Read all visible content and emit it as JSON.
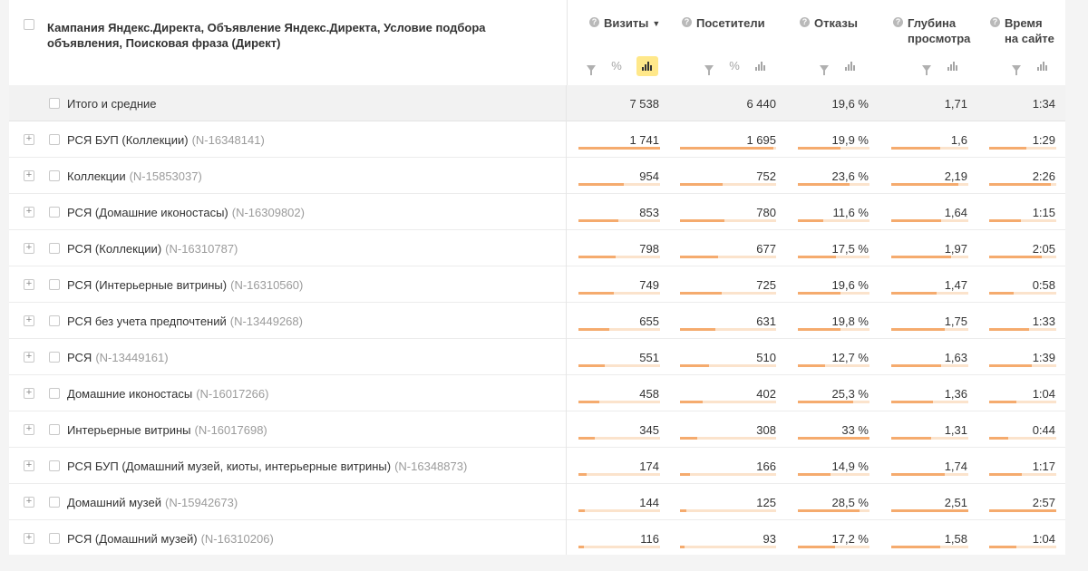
{
  "header": {
    "dimension_title": "Кампания Яндекс.Директа, Объявление Яндекс.Директа, Условие подбора объявления, Поисковая фраза (Директ)",
    "columns": [
      {
        "key": "visits",
        "title_line1": "Визиты",
        "title_line2": "",
        "sorted": true,
        "sort_glyph": "▼"
      },
      {
        "key": "visitors",
        "title_line1": "Посетители",
        "title_line2": "",
        "sorted": false,
        "sort_glyph": ""
      },
      {
        "key": "bounces",
        "title_line1": "Отказы",
        "title_line2": "",
        "sorted": false,
        "sort_glyph": ""
      },
      {
        "key": "depth",
        "title_line1": "Глубина",
        "title_line2": "просмотра",
        "sorted": false,
        "sort_glyph": ""
      },
      {
        "key": "time",
        "title_line1": "Время",
        "title_line2": "на сайте",
        "sorted": false,
        "sort_glyph": ""
      }
    ],
    "help_glyph": "?",
    "percent_glyph": "%"
  },
  "total_row": {
    "label": "Итого и средние",
    "values": [
      "7 538",
      "6 440",
      "19,6 %",
      "1,71",
      "1:34"
    ]
  },
  "rows": [
    {
      "name": "РСЯ БУП (Коллекции)",
      "id": "(N-16348141)",
      "values": [
        "1 741",
        "1 695",
        "19,9 %",
        "1,6",
        "1:29"
      ],
      "fractions": [
        1.0,
        0.97,
        0.6,
        0.64,
        0.56
      ]
    },
    {
      "name": "Коллекции",
      "id": "(N-15853037)",
      "values": [
        "954",
        "752",
        "23,6 %",
        "2,19",
        "2:26"
      ],
      "fractions": [
        0.55,
        0.44,
        0.72,
        0.87,
        0.92
      ]
    },
    {
      "name": "РСЯ (Домашние иконостасы)",
      "id": "(N-16309802)",
      "values": [
        "853",
        "780",
        "11,6 %",
        "1,64",
        "1:15"
      ],
      "fractions": [
        0.49,
        0.46,
        0.35,
        0.65,
        0.47
      ]
    },
    {
      "name": "РСЯ (Коллекции)",
      "id": "(N-16310787)",
      "values": [
        "798",
        "677",
        "17,5 %",
        "1,97",
        "2:05"
      ],
      "fractions": [
        0.46,
        0.4,
        0.53,
        0.78,
        0.79
      ]
    },
    {
      "name": "РСЯ (Интерьерные витрины)",
      "id": "(N-16310560)",
      "values": [
        "749",
        "725",
        "19,6 %",
        "1,47",
        "0:58"
      ],
      "fractions": [
        0.43,
        0.43,
        0.59,
        0.59,
        0.37
      ]
    },
    {
      "name": "РСЯ без учета предпочтений",
      "id": "(N-13449268)",
      "values": [
        "655",
        "631",
        "19,8 %",
        "1,75",
        "1:33"
      ],
      "fractions": [
        0.38,
        0.37,
        0.6,
        0.7,
        0.59
      ]
    },
    {
      "name": "РСЯ",
      "id": "(N-13449161)",
      "values": [
        "551",
        "510",
        "12,7 %",
        "1,63",
        "1:39"
      ],
      "fractions": [
        0.32,
        0.3,
        0.38,
        0.65,
        0.63
      ]
    },
    {
      "name": "Домашние иконостасы",
      "id": "(N-16017266)",
      "values": [
        "458",
        "402",
        "25,3 %",
        "1,36",
        "1:04"
      ],
      "fractions": [
        0.26,
        0.24,
        0.77,
        0.54,
        0.41
      ]
    },
    {
      "name": "Интерьерные витрины",
      "id": "(N-16017698)",
      "values": [
        "345",
        "308",
        "33 %",
        "1,31",
        "0:44"
      ],
      "fractions": [
        0.2,
        0.18,
        1.0,
        0.52,
        0.28
      ]
    },
    {
      "name": "РСЯ БУП (Домашний музей, киоты, интерьерные витрины)",
      "id": "(N-16348873)",
      "values": [
        "174",
        "166",
        "14,9 %",
        "1,74",
        "1:17"
      ],
      "fractions": [
        0.1,
        0.1,
        0.45,
        0.69,
        0.49
      ]
    },
    {
      "name": "Домашний музей",
      "id": "(N-15942673)",
      "values": [
        "144",
        "125",
        "28,5 %",
        "2,51",
        "2:57"
      ],
      "fractions": [
        0.08,
        0.07,
        0.86,
        1.0,
        1.0
      ]
    },
    {
      "name": "РСЯ (Домашний музей)",
      "id": "(N-16310206)",
      "values": [
        "116",
        "93",
        "17,2 %",
        "1,58",
        "1:04"
      ],
      "fractions": [
        0.07,
        0.05,
        0.52,
        0.63,
        0.41
      ]
    }
  ],
  "colors": {
    "bar_fill": "#f5ab6e",
    "bar_track": "#fbe3cc",
    "active_tool": "#ffe88a",
    "id_text": "#9b9b9b"
  },
  "icons": [
    "checkbox-icon",
    "expand-plus-icon",
    "help-icon",
    "filter-icon",
    "percent-icon",
    "bar-chart-icon",
    "sort-desc-icon"
  ]
}
